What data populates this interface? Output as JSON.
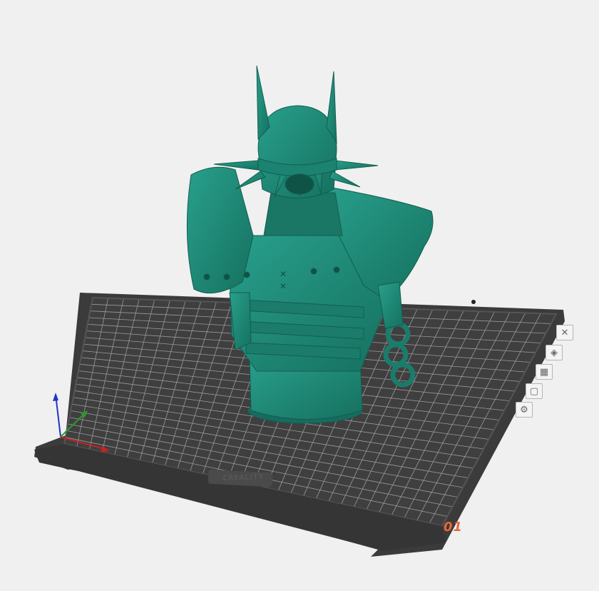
{
  "viewport": {
    "plate_brand": "CREALITY",
    "plate_number": "01",
    "model_color": "#1f8a78",
    "plate_color": "#3b3b3b",
    "background_color": "#f0f0f0",
    "grid_line_color": "#9a9a9a"
  },
  "plate_tabs": [
    {
      "icon": "close-icon",
      "glyph": "✕"
    },
    {
      "icon": "auto-orient-icon",
      "glyph": "◈"
    },
    {
      "icon": "arrange-icon",
      "glyph": "▦"
    },
    {
      "icon": "lock-icon",
      "glyph": "▢"
    },
    {
      "icon": "plate-settings-icon",
      "glyph": "⚙"
    }
  ],
  "axes": {
    "x_color": "#d33",
    "y_color": "#2a2",
    "z_color": "#22d"
  }
}
